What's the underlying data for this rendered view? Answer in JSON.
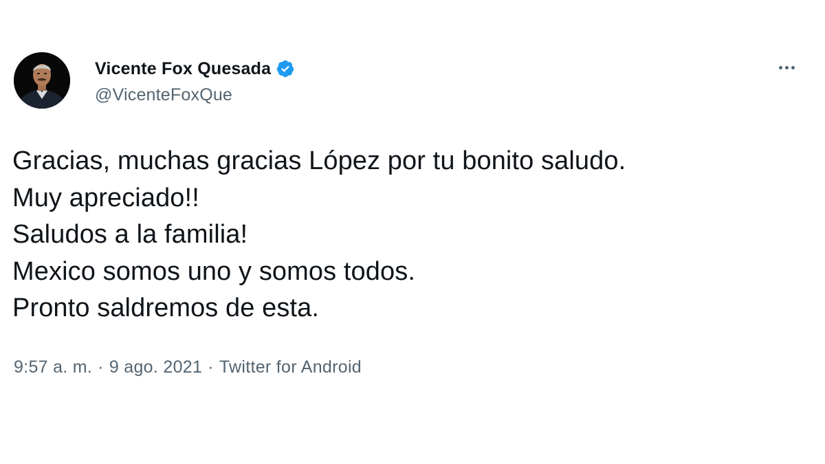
{
  "author": {
    "display_name": "Vicente Fox Quesada",
    "handle": "@VicenteFoxQue",
    "verified": true,
    "avatar_icon": "profile-photo",
    "verified_icon": "verified-badge-icon",
    "verified_color": "#1d9bf0"
  },
  "menu": {
    "icon": "more-options-icon"
  },
  "tweet": {
    "lines": [
      "Gracias, muchas gracias López por tu bonito saludo.",
      "Muy apreciado!!",
      "Saludos a la familia!",
      "Mexico somos uno y somos todos.",
      "Pronto saldremos de esta."
    ]
  },
  "meta": {
    "time": "9:57 a. m.",
    "separator": "·",
    "date": "9 ago. 2021",
    "source": "Twitter for Android"
  },
  "colors": {
    "text": "#0f1419",
    "secondary": "#536471",
    "background": "#ffffff"
  }
}
